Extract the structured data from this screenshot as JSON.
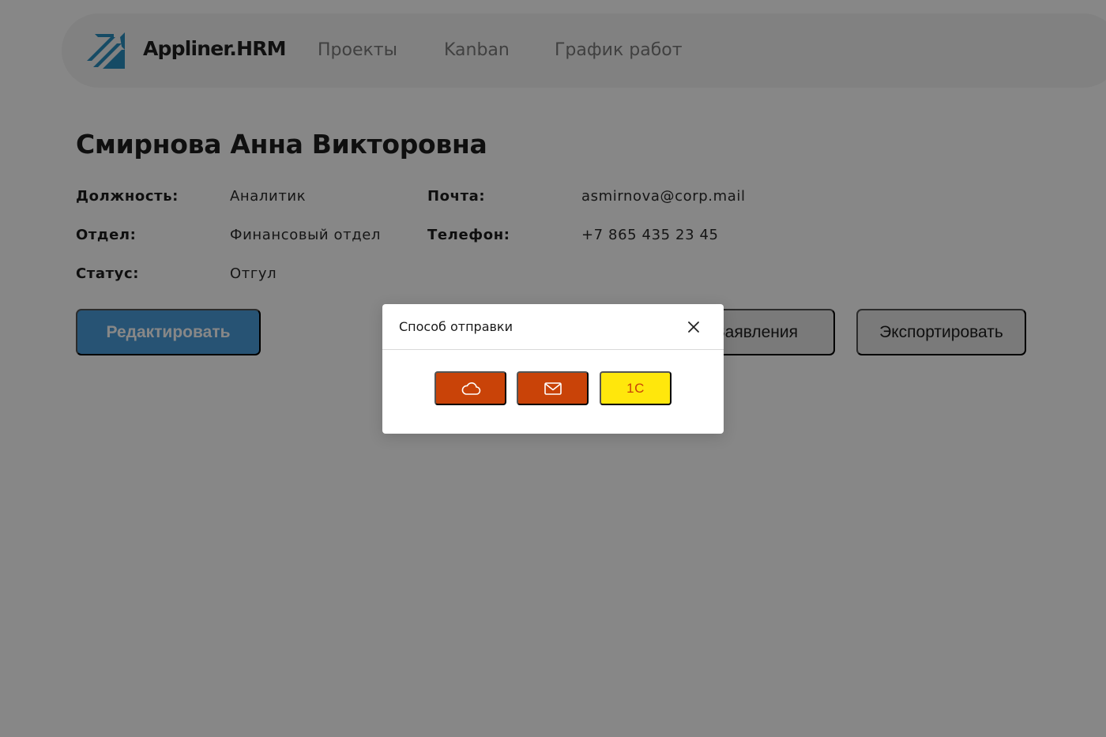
{
  "navbar": {
    "logo_text": "Appliner.HRM",
    "logo_icon": "arrows-logo-icon",
    "links": [
      {
        "label": "Проекты"
      },
      {
        "label": "Kanban"
      },
      {
        "label": "График работ"
      }
    ]
  },
  "employee": {
    "name": "Смирнова Анна Викторовна",
    "fields": {
      "position": {
        "label": "Должность:",
        "value": "Аналитик"
      },
      "department": {
        "label": "Отдел:",
        "value": "Финансовый отдел"
      },
      "status": {
        "label": "Статус:",
        "value": "Отгул"
      },
      "email": {
        "label": "Почта:",
        "value": "asmirnova@corp.mail"
      },
      "phone": {
        "label": "Телефон:",
        "value": "+7 865 435 23 45"
      }
    }
  },
  "actions": {
    "edit_label": "Редактировать",
    "applications_label": "Заявления",
    "export_label": "Экспортировать"
  },
  "modal": {
    "title": "Способ отправки",
    "close_icon": "close-icon",
    "options": [
      {
        "icon": "cloud-icon"
      },
      {
        "icon": "envelope-icon"
      },
      {
        "label": "1С"
      }
    ]
  },
  "colors": {
    "accent_blue": "#4a9edc",
    "send_orange": "#c94308",
    "send_yellow": "#ffe70c",
    "logo_blue": "#2a8fbf"
  }
}
